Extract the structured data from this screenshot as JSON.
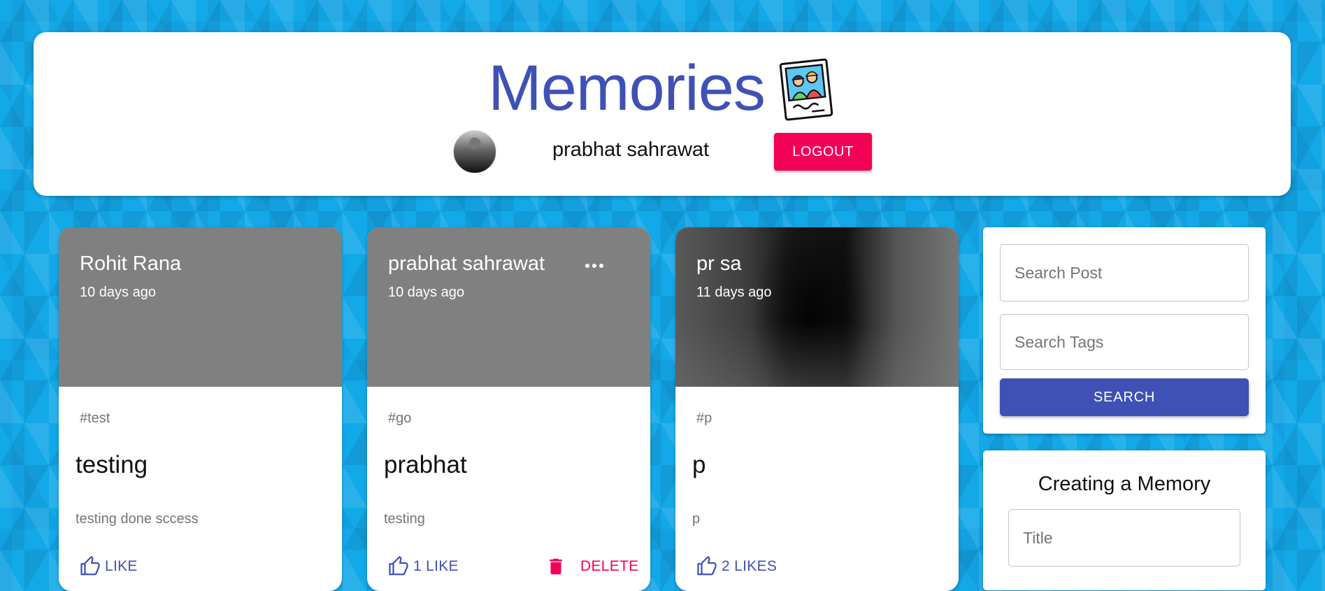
{
  "header": {
    "title": "Memories",
    "user_name": "prabhat sahrawat",
    "logout_label": "LOGOUT"
  },
  "posts": [
    {
      "author": "Rohit Rana",
      "time": "10 days ago",
      "tags": "#test",
      "title": "testing",
      "message": "testing done sccess",
      "like_label": "LIKE",
      "has_image": false
    },
    {
      "author": "prabhat sahrawat",
      "time": "10 days ago",
      "tags": "#go",
      "title": "prabhat",
      "message": "testing",
      "like_label": "1 LIKE",
      "delete_label": "DELETE",
      "has_image": false,
      "has_menu": true
    },
    {
      "author": "pr sa",
      "time": "11 days ago",
      "tags": "#p",
      "title": "p",
      "message": "p",
      "like_label": "2 LIKES",
      "has_image": true
    }
  ],
  "search": {
    "post_placeholder": "Search Post",
    "tags_placeholder": "Search Tags",
    "button_label": "SEARCH"
  },
  "form": {
    "heading": "Creating a Memory",
    "title_placeholder": "Title"
  },
  "colors": {
    "primary": "#3f51b5",
    "secondary": "#f50057",
    "background": "#13a8e8",
    "card_media": "#808080"
  },
  "icons": [
    "memories-logo-icon",
    "more-horizontal-icon",
    "thumb-up-icon",
    "delete-icon"
  ]
}
